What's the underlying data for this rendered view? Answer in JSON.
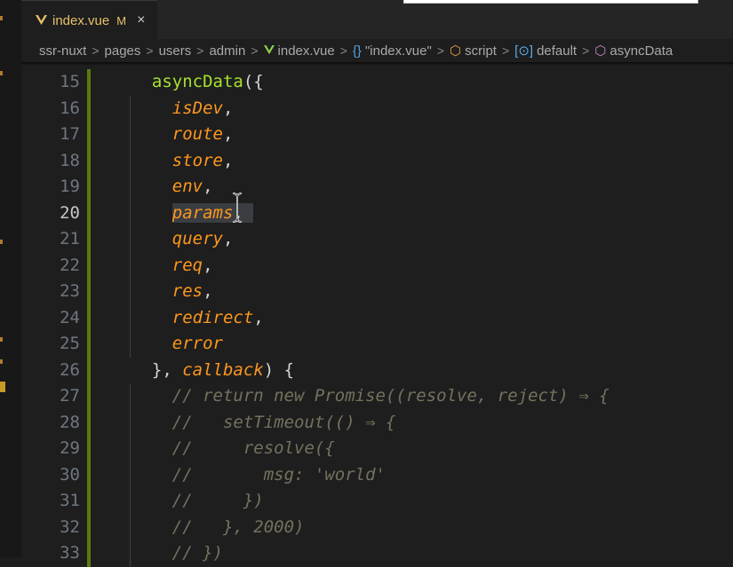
{
  "colors": {
    "editor_bg": "#1e1e1e",
    "tab_label": "#e8c168",
    "keyword_fn": "#a6e22e",
    "param": "#fd971f",
    "comment": "#75715e",
    "gutter_added": "#587c0c"
  },
  "tab": {
    "filename": "index.vue",
    "status": "M",
    "close_label": "×",
    "icon": "vue-icon"
  },
  "breadcrumb": {
    "items": [
      {
        "label": "ssr-nuxt",
        "icon": ""
      },
      {
        "label": "pages",
        "icon": ""
      },
      {
        "label": "users",
        "icon": ""
      },
      {
        "label": "admin",
        "icon": ""
      },
      {
        "label": "index.vue",
        "icon": "vue-icon"
      },
      {
        "label": "\"index.vue\"",
        "icon": "braces-icon"
      },
      {
        "label": "script",
        "icon": "cube-icon"
      },
      {
        "label": "default",
        "icon": "variable-icon"
      },
      {
        "label": "asyncData",
        "icon": "method-icon"
      }
    ],
    "separator": ">"
  },
  "editor": {
    "active_line": 20,
    "lines": [
      {
        "number": "15",
        "tokens": [
          {
            "t": "  asyncData",
            "c": "fn"
          },
          {
            "t": "({",
            "c": "plain"
          }
        ]
      },
      {
        "number": "16",
        "tokens": [
          {
            "t": "    isDev",
            "c": "param"
          },
          {
            "t": ",",
            "c": "plain"
          }
        ]
      },
      {
        "number": "17",
        "tokens": [
          {
            "t": "    route",
            "c": "param"
          },
          {
            "t": ",",
            "c": "plain"
          }
        ]
      },
      {
        "number": "18",
        "tokens": [
          {
            "t": "    store",
            "c": "param"
          },
          {
            "t": ",",
            "c": "plain"
          }
        ]
      },
      {
        "number": "19",
        "tokens": [
          {
            "t": "    env",
            "c": "param"
          },
          {
            "t": ",",
            "c": "plain"
          }
        ]
      },
      {
        "number": "20",
        "tokens": [
          {
            "t": "    ",
            "c": "plain"
          },
          {
            "t": "params",
            "c": "param hl"
          },
          {
            "t": ", ",
            "c": "plain hl"
          }
        ]
      },
      {
        "number": "21",
        "tokens": [
          {
            "t": "    query",
            "c": "param"
          },
          {
            "t": ",",
            "c": "plain"
          }
        ]
      },
      {
        "number": "22",
        "tokens": [
          {
            "t": "    req",
            "c": "param"
          },
          {
            "t": ",",
            "c": "plain"
          }
        ]
      },
      {
        "number": "23",
        "tokens": [
          {
            "t": "    res",
            "c": "param"
          },
          {
            "t": ",",
            "c": "plain"
          }
        ]
      },
      {
        "number": "24",
        "tokens": [
          {
            "t": "    redirect",
            "c": "param"
          },
          {
            "t": ",",
            "c": "plain"
          }
        ]
      },
      {
        "number": "25",
        "tokens": [
          {
            "t": "    error",
            "c": "param"
          }
        ]
      },
      {
        "number": "26",
        "tokens": [
          {
            "t": "  }, ",
            "c": "plain"
          },
          {
            "t": "callback",
            "c": "param"
          },
          {
            "t": ") {",
            "c": "plain"
          }
        ]
      },
      {
        "number": "27",
        "tokens": [
          {
            "t": "    // return new Promise((resolve, reject) ⇒ {",
            "c": "comment"
          }
        ]
      },
      {
        "number": "28",
        "tokens": [
          {
            "t": "    //   setTimeout(() ⇒ {",
            "c": "comment"
          }
        ]
      },
      {
        "number": "29",
        "tokens": [
          {
            "t": "    //     resolve({",
            "c": "comment"
          }
        ]
      },
      {
        "number": "30",
        "tokens": [
          {
            "t": "    //       msg: 'world'",
            "c": "comment"
          }
        ]
      },
      {
        "number": "31",
        "tokens": [
          {
            "t": "    //     })",
            "c": "comment"
          }
        ]
      },
      {
        "number": "32",
        "tokens": [
          {
            "t": "    //   }, 2000)",
            "c": "comment"
          }
        ]
      },
      {
        "number": "33",
        "tokens": [
          {
            "t": "    // })",
            "c": "comment"
          }
        ]
      }
    ]
  }
}
